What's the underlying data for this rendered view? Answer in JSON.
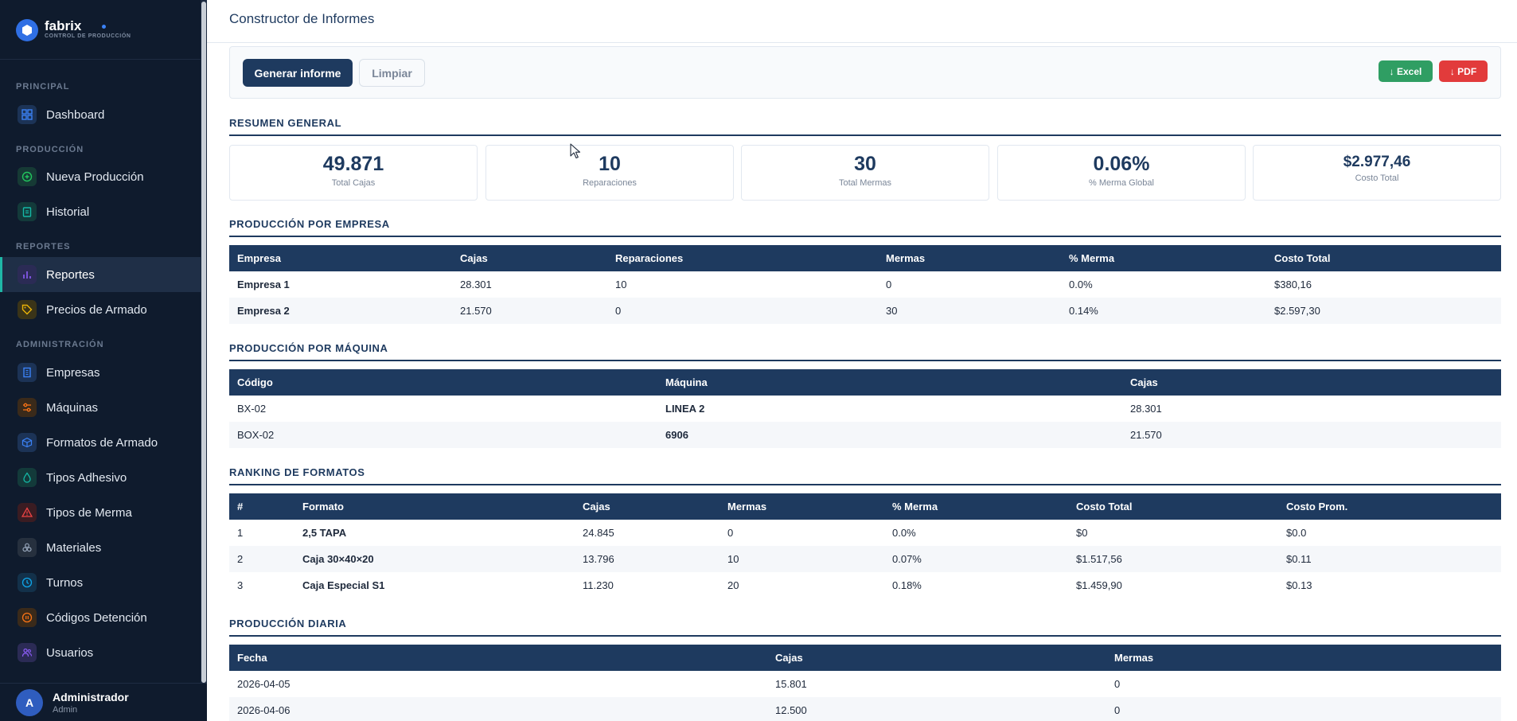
{
  "brand": {
    "name": "fabrix",
    "subtitle": "CONTROL DE PRODUCCIÓN"
  },
  "sidebar": {
    "sections": [
      {
        "label": "PRINCIPAL"
      },
      {
        "label": "PRODUCCIÓN"
      },
      {
        "label": "REPORTES"
      },
      {
        "label": "ADMINISTRACIÓN"
      }
    ],
    "items": [
      {
        "label": "Dashboard",
        "icon": "grid-icon",
        "color": "#3b82f6"
      },
      {
        "label": "Nueva Producción",
        "icon": "plus-circle-icon",
        "color": "#22c55e"
      },
      {
        "label": "Historial",
        "icon": "clipboard-icon",
        "color": "#14b8a6"
      },
      {
        "label": "Reportes",
        "icon": "bar-chart-icon",
        "color": "#8b5cf6"
      },
      {
        "label": "Precios de Armado",
        "icon": "tag-icon",
        "color": "#eab308"
      },
      {
        "label": "Empresas",
        "icon": "building-icon",
        "color": "#3b82f6"
      },
      {
        "label": "Máquinas",
        "icon": "sliders-icon",
        "color": "#f97316"
      },
      {
        "label": "Formatos de Armado",
        "icon": "box-icon",
        "color": "#3b82f6"
      },
      {
        "label": "Tipos Adhesivo",
        "icon": "droplet-icon",
        "color": "#14b8a6"
      },
      {
        "label": "Tipos de Merma",
        "icon": "warning-icon",
        "color": "#ef4444"
      },
      {
        "label": "Materiales",
        "icon": "layers-icon",
        "color": "#94a3b8"
      },
      {
        "label": "Turnos",
        "icon": "clock-icon",
        "color": "#0ea5e9"
      },
      {
        "label": "Códigos Detención",
        "icon": "pause-circle-icon",
        "color": "#f97316"
      },
      {
        "label": "Usuarios",
        "icon": "users-icon",
        "color": "#8b5cf6"
      }
    ]
  },
  "user": {
    "initial": "A",
    "name": "Administrador",
    "role": "Admin"
  },
  "header": {
    "title": "Constructor de Informes"
  },
  "toolbar": {
    "generate_label": "Generar informe",
    "clear_label": "Limpiar",
    "excel_label": "↓ Excel",
    "pdf_label": "↓ PDF"
  },
  "summary": {
    "title": "RESUMEN GENERAL",
    "kpis": [
      {
        "value": "49.871",
        "label": "Total Cajas"
      },
      {
        "value": "10",
        "label": "Reparaciones"
      },
      {
        "value": "30",
        "label": "Total Mermas"
      },
      {
        "value": "0.06%",
        "label": "% Merma Global"
      },
      {
        "value": "$2.977,46",
        "label": "Costo Total"
      }
    ]
  },
  "by_company": {
    "title": "PRODUCCIÓN POR EMPRESA",
    "headers": [
      "Empresa",
      "Cajas",
      "Reparaciones",
      "Mermas",
      "% Merma",
      "Costo Total"
    ],
    "rows": [
      [
        "Empresa 1",
        "28.301",
        "10",
        "0",
        "0.0%",
        "$380,16"
      ],
      [
        "Empresa 2",
        "21.570",
        "0",
        "30",
        "0.14%",
        "$2.597,30"
      ]
    ]
  },
  "by_machine": {
    "title": "PRODUCCIÓN POR MÁQUINA",
    "headers": [
      "Código",
      "Máquina",
      "Cajas"
    ],
    "rows": [
      [
        "BX-02",
        "LINEA 2",
        "28.301"
      ],
      [
        "BOX-02",
        "6906",
        "21.570"
      ]
    ]
  },
  "ranking": {
    "title": "RANKING DE FORMATOS",
    "headers": [
      "#",
      "Formato",
      "Cajas",
      "Mermas",
      "% Merma",
      "Costo Total",
      "Costo Prom."
    ],
    "rows": [
      [
        "1",
        "2,5 TAPA",
        "24.845",
        "0",
        "0.0%",
        "$0",
        "$0.0"
      ],
      [
        "2",
        "Caja 30×40×20",
        "13.796",
        "10",
        "0.07%",
        "$1.517,56",
        "$0.11"
      ],
      [
        "3",
        "Caja Especial S1",
        "11.230",
        "20",
        "0.18%",
        "$1.459,90",
        "$0.13"
      ]
    ]
  },
  "daily": {
    "title": "PRODUCCIÓN DIARIA",
    "headers": [
      "Fecha",
      "Cajas",
      "Mermas"
    ],
    "rows": [
      [
        "2026-04-05",
        "15.801",
        "0"
      ],
      [
        "2026-04-06",
        "12.500",
        "0"
      ]
    ]
  }
}
